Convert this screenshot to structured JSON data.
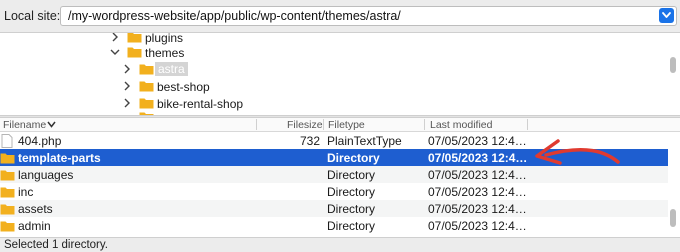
{
  "local_site": {
    "label": "Local site:",
    "path": "/my-wordpress-website/app/public/wp-content/themes/astra/"
  },
  "tree": {
    "items": [
      {
        "name": "plugins",
        "expanded": false,
        "selected": false
      },
      {
        "name": "themes",
        "expanded": true,
        "selected": false
      },
      {
        "name": "astra",
        "expanded": false,
        "selected": true
      },
      {
        "name": "best-shop",
        "expanded": false,
        "selected": false
      },
      {
        "name": "bike-rental-shop",
        "expanded": false,
        "selected": false
      }
    ]
  },
  "table": {
    "columns": {
      "filename": "Filename",
      "filesize": "Filesize",
      "filetype": "Filetype",
      "last_modified": "Last modified"
    },
    "sort_indicator": "descending",
    "rows": [
      {
        "name": "404.php",
        "size": "732",
        "type": "PlainTextType",
        "modified": "07/05/2023 12:4…",
        "icon": "file-icon",
        "selected": false
      },
      {
        "name": "template-parts",
        "size": "",
        "type": "Directory",
        "modified": "07/05/2023 12:4…",
        "icon": "folder-icon",
        "selected": true
      },
      {
        "name": "languages",
        "size": "",
        "type": "Directory",
        "modified": "07/05/2023 12:4…",
        "icon": "folder-icon",
        "selected": false
      },
      {
        "name": "inc",
        "size": "",
        "type": "Directory",
        "modified": "07/05/2023 12:4…",
        "icon": "folder-icon",
        "selected": false
      },
      {
        "name": "assets",
        "size": "",
        "type": "Directory",
        "modified": "07/05/2023 12:4…",
        "icon": "folder-icon",
        "selected": false
      },
      {
        "name": "admin",
        "size": "",
        "type": "Directory",
        "modified": "07/05/2023 12:4…",
        "icon": "folder-icon",
        "selected": false
      }
    ]
  },
  "status": {
    "text": "Selected 1 directory."
  },
  "colors": {
    "selection": "#1e5ed0",
    "folder": "#f2b01e",
    "annotation_arrow": "#e03a2f",
    "dropdown_button": "#1a73e8"
  }
}
